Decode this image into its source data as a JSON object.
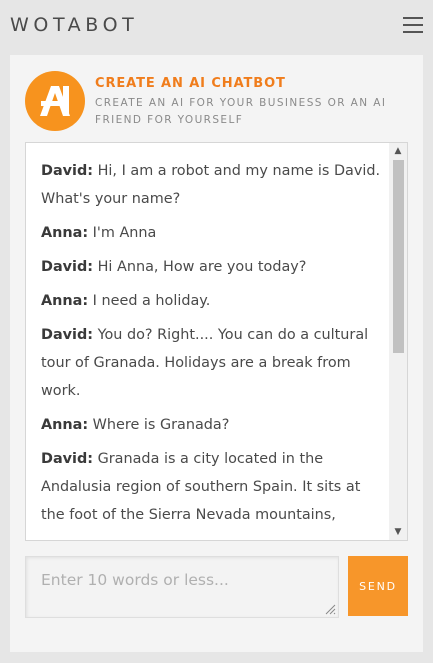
{
  "header": {
    "brand": "WOTABOT",
    "menu_icon": "hamburger-menu-icon"
  },
  "intro": {
    "logo_icon": "wotabot-logo-icon",
    "title": "CREATE AN AI CHATBOT",
    "subtitle": "CREATE AN AI FOR YOUR BUSINESS OR AN AI FRIEND FOR YOURSELF"
  },
  "chat": {
    "messages": [
      {
        "speaker": "David:",
        "text": "Hi, I am a robot and my name is David. What's your name?"
      },
      {
        "speaker": "Anna:",
        "text": "I'm Anna"
      },
      {
        "speaker": "David:",
        "text": "Hi Anna, How are you today?"
      },
      {
        "speaker": "Anna:",
        "text": "I need a holiday."
      },
      {
        "speaker": "David:",
        "text": "You do? Right.... You can do a cultural tour of Granada. Holidays are a break from work."
      },
      {
        "speaker": "Anna:",
        "text": "Where is Granada?"
      },
      {
        "speaker": "David:",
        "text": "Granada is a city located in the Andalusia region of southern Spain. It sits at the foot of the Sierra Nevada mountains,"
      }
    ],
    "scroll_up_icon": "scroll-up-arrow-icon",
    "scroll_down_icon": "scroll-down-arrow-icon"
  },
  "composer": {
    "placeholder": "Enter 10 words or less...",
    "value": "",
    "send_label": "SEND"
  },
  "colors": {
    "accent": "#f7931e",
    "title_orange": "#f07d1c",
    "background": "#e6e6e6",
    "panel": "#f4f4f4"
  }
}
